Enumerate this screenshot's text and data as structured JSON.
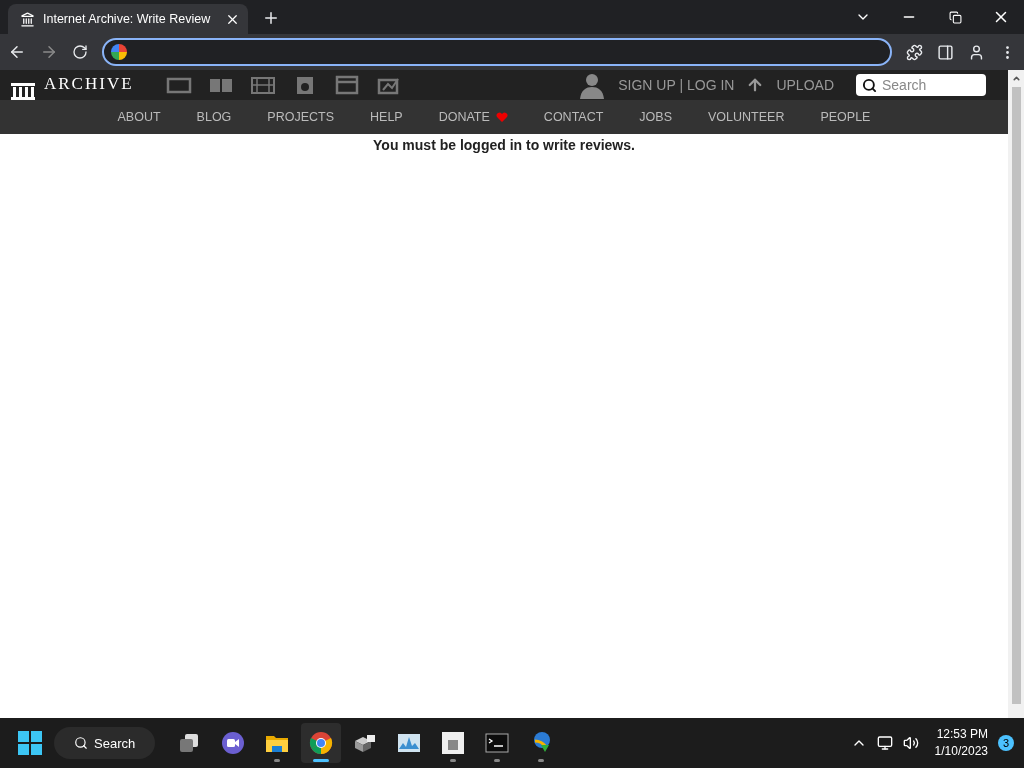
{
  "browser": {
    "tab": {
      "title": "Internet Archive: Write Review",
      "selected": true
    }
  },
  "site": {
    "logo": "ARCHIVE",
    "media": [
      {
        "kind": "web"
      },
      {
        "kind": "texts"
      },
      {
        "kind": "video"
      },
      {
        "kind": "audio"
      },
      {
        "kind": "software"
      },
      {
        "kind": "images"
      }
    ],
    "account": "SIGN UP | LOG IN",
    "upload": "UPLOAD",
    "search": {
      "placeholder": "Search"
    },
    "nav": [
      {
        "label": "ABOUT",
        "heart": false
      },
      {
        "label": "BLOG",
        "heart": false
      },
      {
        "label": "PROJECTS",
        "heart": false
      },
      {
        "label": "HELP",
        "heart": false
      },
      {
        "label": "DONATE",
        "heart": true
      },
      {
        "label": "CONTACT",
        "heart": false
      },
      {
        "label": "JOBS",
        "heart": false
      },
      {
        "label": "VOLUNTEER",
        "heart": false
      },
      {
        "label": "PEOPLE",
        "heart": false
      }
    ],
    "message": "You must be logged in to write reviews."
  },
  "taskbar": {
    "search": "Search",
    "apps": [
      {
        "kind": "taskview",
        "running": false,
        "selected": false
      },
      {
        "kind": "meet",
        "running": false,
        "selected": false
      },
      {
        "kind": "folder",
        "running": true,
        "selected": false
      },
      {
        "kind": "chrome",
        "running": true,
        "selected": true
      },
      {
        "kind": "boxes",
        "running": false,
        "selected": false
      },
      {
        "kind": "monitor",
        "running": false,
        "selected": false
      },
      {
        "kind": "paint",
        "running": true,
        "selected": false
      },
      {
        "kind": "terminal",
        "running": true,
        "selected": false
      },
      {
        "kind": "download",
        "running": true,
        "selected": false
      }
    ],
    "time": "12:53 PM",
    "date": "1/10/2023",
    "badge": "3"
  }
}
